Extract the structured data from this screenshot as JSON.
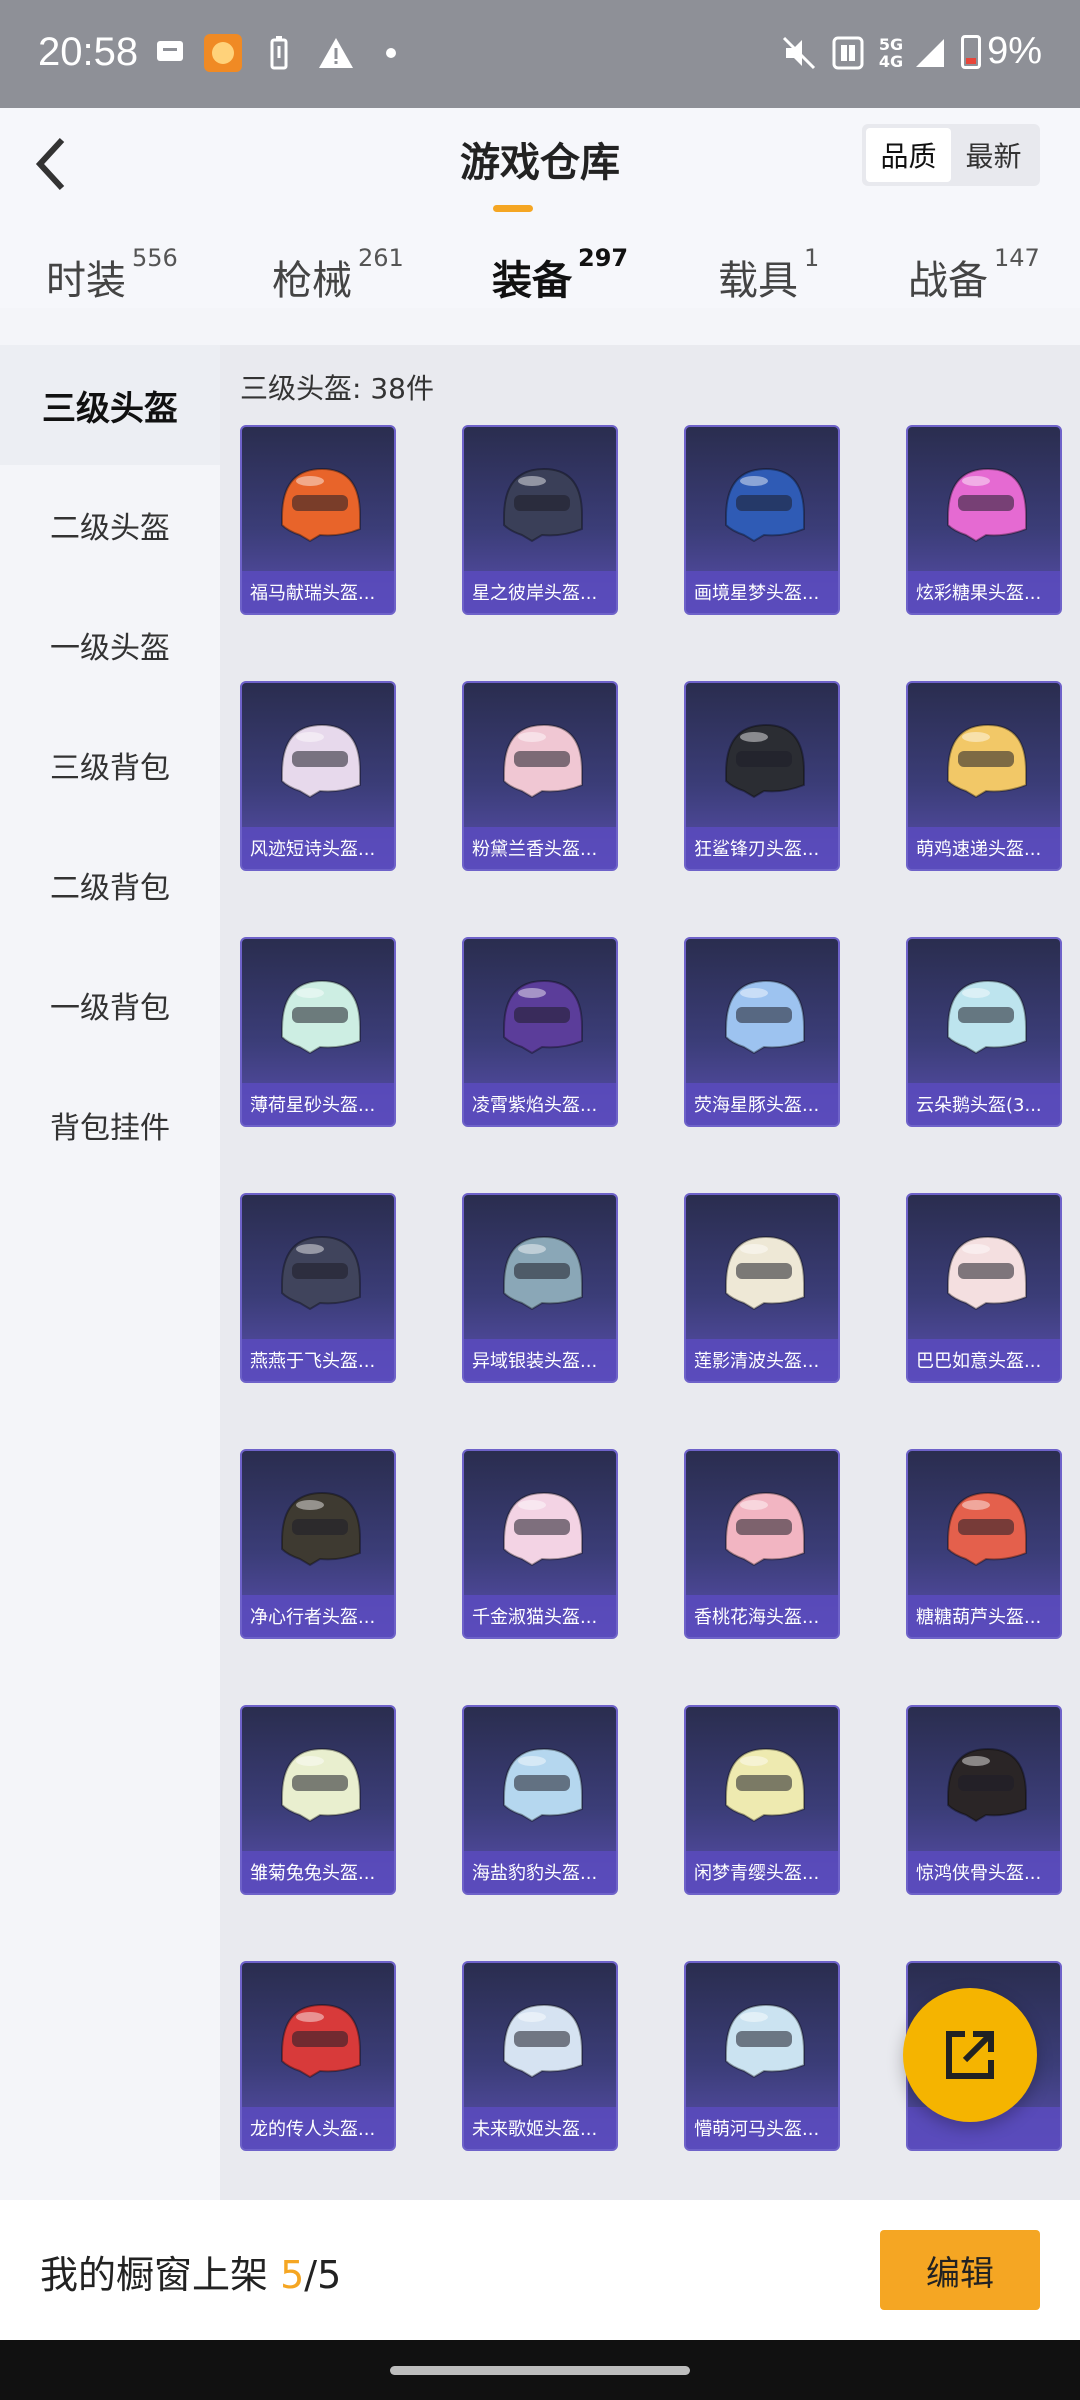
{
  "status_bar": {
    "time": "20:58",
    "network": "5G 4G",
    "battery": "9%"
  },
  "header": {
    "title": "游戏仓库",
    "sort_options": [
      "品质",
      "最新"
    ],
    "sort_active": "品质"
  },
  "tabs": [
    {
      "label": "时装",
      "count": "556"
    },
    {
      "label": "枪械",
      "count": "261"
    },
    {
      "label": "装备",
      "count": "297",
      "active": true
    },
    {
      "label": "载具",
      "count": "1"
    },
    {
      "label": "战备",
      "count": "147"
    }
  ],
  "sidebar": {
    "items": [
      "三级头盔",
      "二级头盔",
      "一级头盔",
      "三级背包",
      "二级背包",
      "一级背包",
      "背包挂件"
    ],
    "active": "三级头盔"
  },
  "content": {
    "title": "三级头盔: 38件",
    "items": [
      {
        "name": "福马献瑞头盔...",
        "color": "#e8642a"
      },
      {
        "name": "星之彼岸头盔...",
        "color": "#3a3f58"
      },
      {
        "name": "画境星梦头盔...",
        "color": "#2f5bb5"
      },
      {
        "name": "炫彩糖果头盔...",
        "color": "#e56ad2"
      },
      {
        "name": "风迹短诗头盔...",
        "color": "#e7d9ec"
      },
      {
        "name": "粉黛兰香头盔...",
        "color": "#f0c7d3"
      },
      {
        "name": "狂鲨锋刃头盔...",
        "color": "#2b2d33"
      },
      {
        "name": "萌鸡速递头盔...",
        "color": "#f2c867"
      },
      {
        "name": "薄荷星砂头盔...",
        "color": "#cdeee3"
      },
      {
        "name": "凌霄紫焰头盔...",
        "color": "#5b3d9a"
      },
      {
        "name": "荧海星豚头盔...",
        "color": "#9dc3f0"
      },
      {
        "name": "云朵鹅头盔(3...",
        "color": "#bde4ee"
      },
      {
        "name": "燕燕于飞头盔...",
        "color": "#40445c"
      },
      {
        "name": "异域银装头盔...",
        "color": "#8aa7b7"
      },
      {
        "name": "莲影清波头盔...",
        "color": "#eee8d6"
      },
      {
        "name": "巴巴如意头盔...",
        "color": "#f4dfe0"
      },
      {
        "name": "净心行者头盔...",
        "color": "#3e3a31"
      },
      {
        "name": "千金淑猫头盔...",
        "color": "#f3d3e4"
      },
      {
        "name": "香桃花海头盔...",
        "color": "#f2b5c2"
      },
      {
        "name": "糖糖葫芦头盔...",
        "color": "#e4604c"
      },
      {
        "name": "雏菊兔兔头盔...",
        "color": "#e9efcf"
      },
      {
        "name": "海盐豹豹头盔...",
        "color": "#b5d7ef"
      },
      {
        "name": "闲梦青缨头盔...",
        "color": "#eeeab0"
      },
      {
        "name": "惊鸿侠骨头盔...",
        "color": "#2a2526"
      },
      {
        "name": "龙的传人头盔...",
        "color": "#d83a3a"
      },
      {
        "name": "未来歌姬头盔...",
        "color": "#d6e3f2"
      },
      {
        "name": "懵萌河马头盔...",
        "color": "#cbe3f1"
      },
      {
        "name": "",
        "color": "#e9e2e2"
      }
    ]
  },
  "bottom": {
    "shelf_prefix": "我的橱窗上架 ",
    "shelf_current": "5",
    "shelf_total": "/5",
    "edit_label": "编辑"
  }
}
